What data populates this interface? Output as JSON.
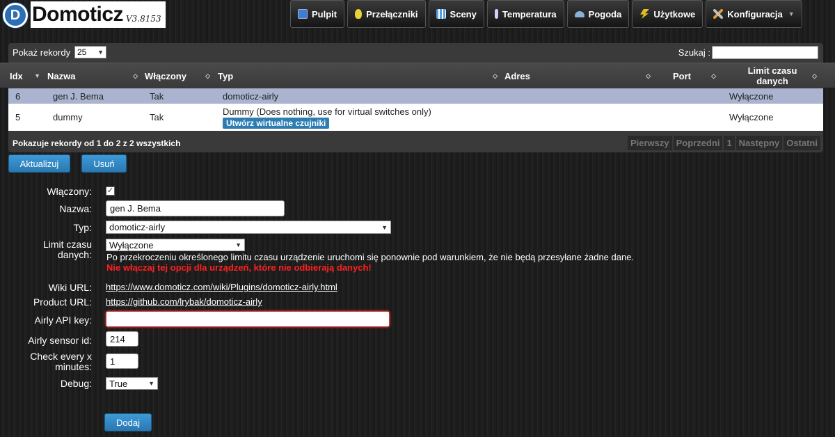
{
  "app": {
    "name": "Domoticz",
    "version": "V3.8153",
    "logo_letter": "D"
  },
  "nav": [
    {
      "label": "Pulpit",
      "icon": "dashboard-icon",
      "color": "#3a7fd0"
    },
    {
      "label": "Przełączniki",
      "icon": "lightbulb-icon",
      "color": "#e8d23a"
    },
    {
      "label": "Sceny",
      "icon": "scenes-icon",
      "color": "#5aa0e0"
    },
    {
      "label": "Temperatura",
      "icon": "thermometer-icon",
      "color": "#d0d0ff"
    },
    {
      "label": "Pogoda",
      "icon": "weather-icon",
      "color": "#8ab0d8"
    },
    {
      "label": "Użytkowe",
      "icon": "utility-icon",
      "color": "#e0c020"
    },
    {
      "label": "Konfiguracja",
      "icon": "tools-icon",
      "color": "#c0c0c0"
    }
  ],
  "table": {
    "length_label": "Pokaż rekordy",
    "length_value": "25",
    "search_label": "Szukaj :",
    "columns": [
      "Idx",
      "Nazwa",
      "Włączony",
      "Typ",
      "Adres",
      "Port",
      "Limit czasu danych"
    ],
    "rows": [
      {
        "idx": "6",
        "name": "gen J. Bema",
        "enabled": "Tak",
        "type": "domoticz-airly",
        "address": "",
        "port": "",
        "timeout": "Wyłączone",
        "button": ""
      },
      {
        "idx": "5",
        "name": "dummy",
        "enabled": "Tak",
        "type": "Dummy (Does nothing, use for virtual switches only)",
        "address": "",
        "port": "",
        "timeout": "Wyłączone",
        "button": "Utwórz wirtualne czujniki"
      }
    ],
    "info": "Pokazuje rekordy od 1 do 2 z 2 wszystkich",
    "pager": {
      "first": "Pierwszy",
      "prev": "Poprzedni",
      "page": "1",
      "next": "Następny",
      "last": "Ostatni"
    }
  },
  "actions": {
    "update": "Aktualizuj",
    "delete": "Usuń"
  },
  "form": {
    "enabled_label": "Włączony:",
    "enabled_checked": "✓",
    "name_label": "Nazwa:",
    "name_value": "gen J. Bema",
    "type_label": "Typ:",
    "type_value": "domoticz-airly",
    "timeout_label_1": "Limit czasu",
    "timeout_label_2": "danych:",
    "timeout_value": "Wyłączone",
    "timeout_help": "Po przekroczeniu określonego limitu czasu urządzenie uruchomi się ponownie pod warunkiem, że nie będą przesyłane żadne dane.",
    "timeout_warning": "Nie włączaj tej opcji dla urządzeń, które nie odbierają danych!",
    "wiki_label": "Wiki URL:",
    "wiki_url": "https://www.domoticz.com/wiki/Plugins/domoticz-airly.html",
    "product_label": "Product URL:",
    "product_url": "https://github.com/lrybak/domoticz-airly",
    "apikey_label": "Airly API key:",
    "apikey_value": "",
    "sensor_label": "Airly sensor id:",
    "sensor_value": "214",
    "check_label_1": "Check every x",
    "check_label_2": "minutes:",
    "check_value": "1",
    "debug_label": "Debug:",
    "debug_value": "True",
    "add_button": "Dodaj"
  },
  "colors": {
    "accent": "#2d7db3",
    "selected_row": "#aab4d0",
    "warning": "#ff2020"
  }
}
